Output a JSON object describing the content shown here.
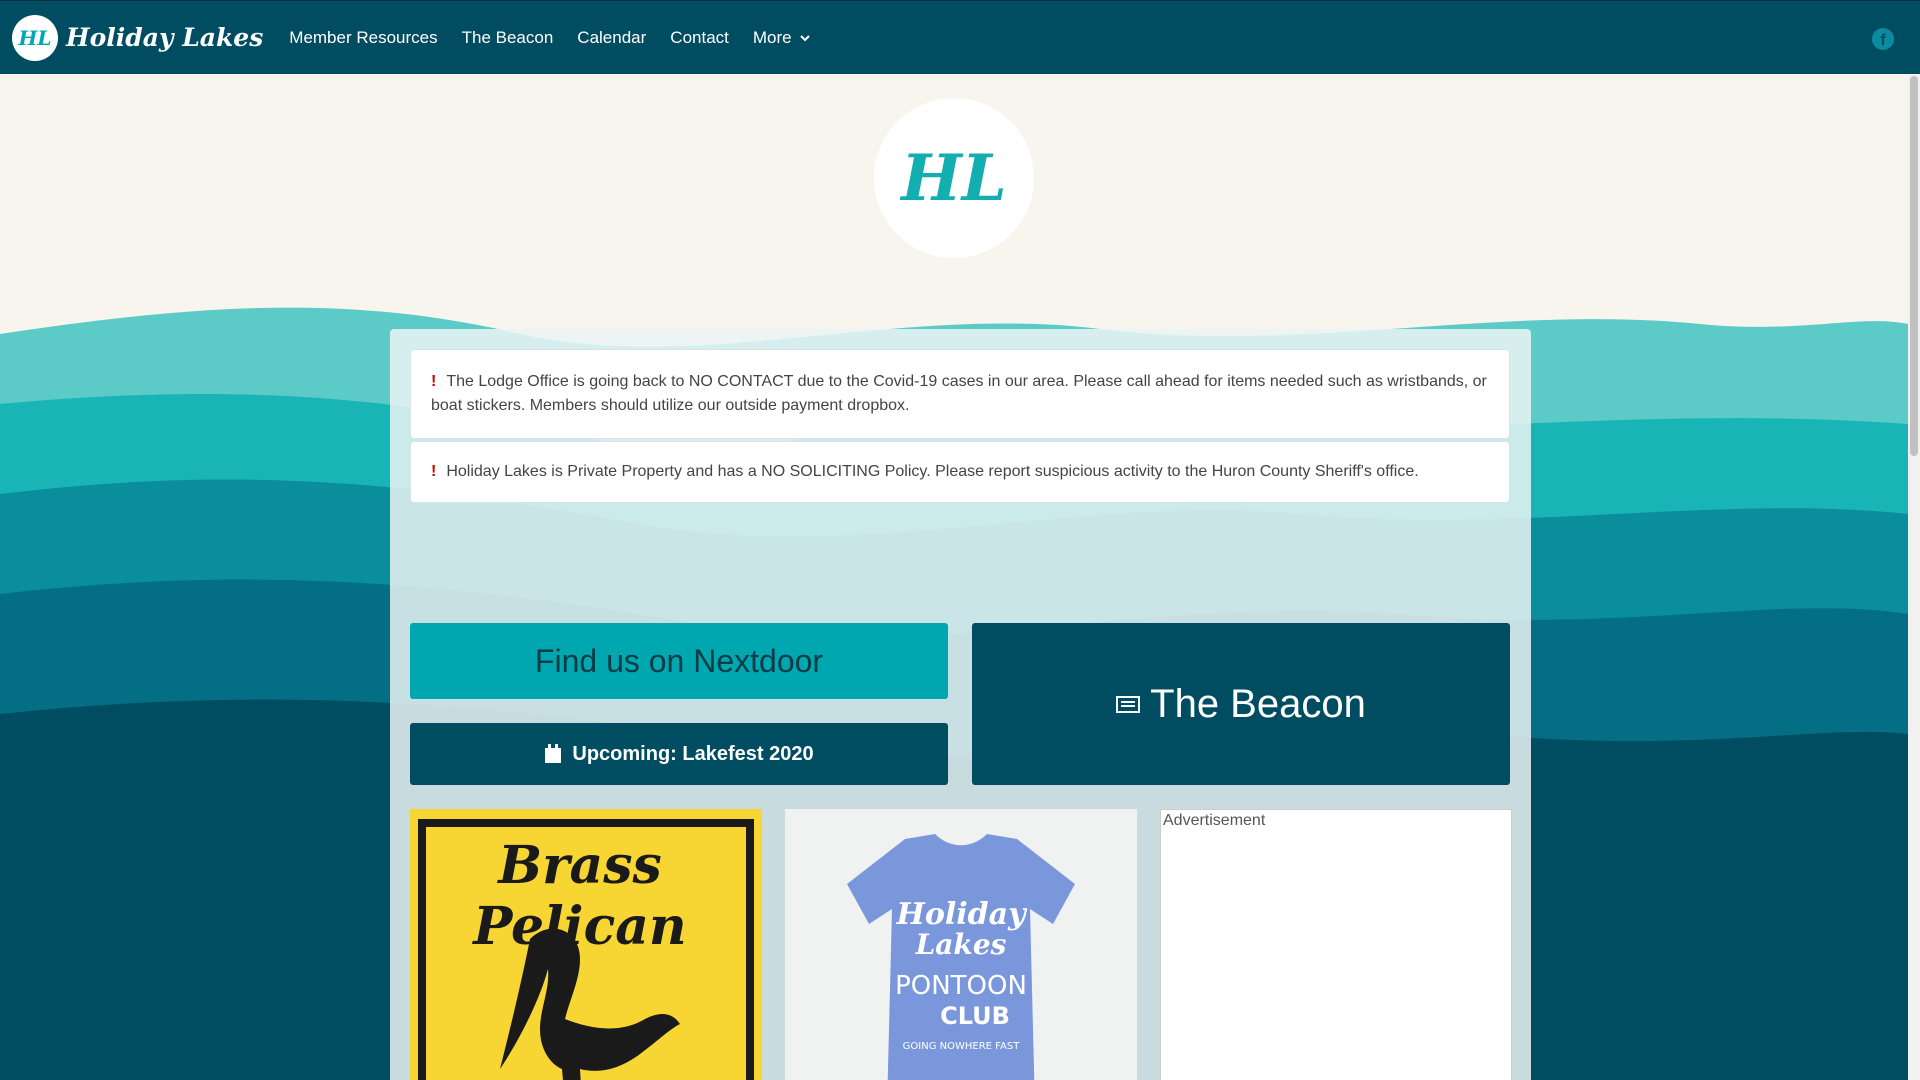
{
  "nav": {
    "brand_logo": "HL",
    "brand_name": "Holiday Lakes",
    "links": [
      "Member Resources",
      "The Beacon",
      "Calendar",
      "Contact",
      "More"
    ],
    "facebook_icon": "facebook-icon"
  },
  "hero": {
    "logo_text": "HL"
  },
  "alerts": [
    {
      "icon": "!",
      "text": "The Lodge Office is going back to NO CONTACT due to the Covid-19 cases in our area. Please call ahead for items needed such as wristbands, or boat stickers. Members should utilize our outside payment dropbox."
    },
    {
      "icon": "!",
      "text": "Holiday Lakes is Private Property and has a NO SOLICITING Policy. Please report suspicious activity to the Huron County Sheriff's office."
    }
  ],
  "buttons": {
    "nextdoor": "Find us on Nextdoor",
    "upcoming": "Upcoming:  Lakefest 2020",
    "beacon": "The Beacon"
  },
  "cards": {
    "pelican_title": "Brass Pelican",
    "shirt_lines": [
      "Holiday",
      "Lakes",
      "PONTOON",
      "CLUB",
      "GOING NOWHERE FAST"
    ],
    "ad_label": "Advertisement"
  },
  "colors": {
    "nav": "#004d61",
    "teal": "#00a6b0",
    "dark": "#004d61",
    "cream": "#f7f5ee",
    "alert_icon": "#d00000"
  }
}
